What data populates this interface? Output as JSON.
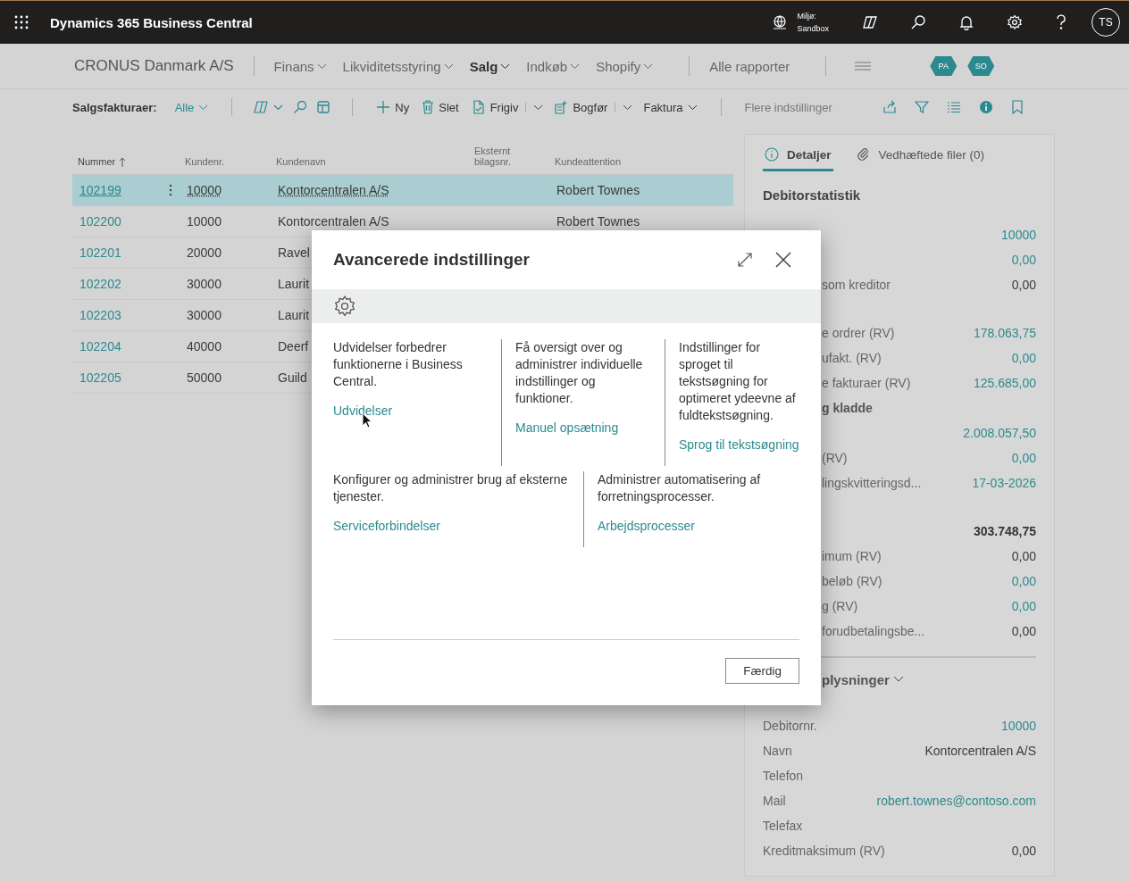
{
  "top_bar": {
    "title": "Dynamics 365 Business Central",
    "environment_label": "Miljø:",
    "environment": "Sandbox",
    "avatar": "TS"
  },
  "nav": {
    "company": "CRONUS Danmark A/S",
    "menus": [
      {
        "label": "Finans",
        "selected": false
      },
      {
        "label": "Likviditetsstyring",
        "selected": false
      },
      {
        "label": "Salg",
        "selected": true
      },
      {
        "label": "Indkøb",
        "selected": false
      },
      {
        "label": "Shopify",
        "selected": false
      }
    ],
    "reports": "Alle rapporter",
    "badges": [
      "PA",
      "SO"
    ]
  },
  "action_bar": {
    "page": "Salgsfakturaer:",
    "filter": "Alle",
    "actions": [
      {
        "label": "Ny",
        "kind": "plain"
      },
      {
        "label": "Slet",
        "kind": "plain"
      },
      {
        "label": "Frigiv",
        "kind": "split"
      },
      {
        "label": "Bogfør",
        "kind": "split"
      },
      {
        "label": "Faktura",
        "kind": "menu"
      }
    ],
    "more": "Flere indstillinger"
  },
  "table": {
    "columns": [
      {
        "label": "Nummer",
        "sorted": true
      },
      {
        "label": "Kundenr.",
        "sorted": false
      },
      {
        "label": "Kundenavn",
        "sorted": false
      },
      {
        "label": "Eksternt bilagsnr.",
        "sorted": false
      },
      {
        "label": "Kundeattention",
        "sorted": false
      }
    ],
    "rows": [
      {
        "number": "102199",
        "customer_no": "10000",
        "name": "Kontorcentralen A/S",
        "attention": "Robert Townes",
        "selected": true
      },
      {
        "number": "102200",
        "customer_no": "10000",
        "name": "Kontorcentralen A/S",
        "attention": "Robert Townes",
        "selected": false
      },
      {
        "number": "102201",
        "customer_no": "20000",
        "name": "Ravel",
        "selected": false
      },
      {
        "number": "102202",
        "customer_no": "30000",
        "name": "Laurit",
        "selected": false
      },
      {
        "number": "102203",
        "customer_no": "30000",
        "name": "Laurit",
        "selected": false
      },
      {
        "number": "102204",
        "customer_no": "40000",
        "name": "Deerf",
        "selected": false
      },
      {
        "number": "102205",
        "customer_no": "50000",
        "name": "Guild",
        "selected": false
      }
    ]
  },
  "factbox": {
    "tabs": [
      {
        "label": "Detaljer",
        "selected": true
      },
      {
        "label": "Vedhæftede filer (0)",
        "selected": false
      }
    ],
    "stats_title": "Debitorstatistik",
    "stats": [
      {
        "kind": "link",
        "value": "10000"
      },
      {
        "kind": "link",
        "value": "0,00"
      },
      {
        "kind": "text",
        "label": "som kreditor",
        "value": "0,00"
      },
      {
        "kind": "gap"
      },
      {
        "kind": "link",
        "label": "e ordrer (RV)",
        "value": "178.063,75"
      },
      {
        "kind": "link",
        "label": "ufakt. (RV)",
        "value": "0,00"
      },
      {
        "kind": "link",
        "label": "e fakturaer (RV)",
        "value": "125.685,00"
      },
      {
        "kind": "heading",
        "label": "g kladde"
      },
      {
        "kind": "link",
        "value": "2.008.057,50"
      },
      {
        "kind": "link",
        "label": "(RV)",
        "value": "0,00"
      },
      {
        "kind": "link",
        "label": "lingskvitteringsd...",
        "value": "17-03-2026"
      },
      {
        "kind": "gap"
      },
      {
        "kind": "total",
        "value": "303.748,75"
      },
      {
        "kind": "text",
        "label": "imum (RV)",
        "value": "0,00"
      },
      {
        "kind": "link",
        "label": "beløb (RV)",
        "value": "0,00"
      },
      {
        "kind": "link",
        "label": "g (RV)",
        "value": "0,00"
      },
      {
        "kind": "text",
        "label": "forudbetalingsbe...",
        "value": "0,00"
      }
    ],
    "info_title": "plysninger",
    "info": [
      {
        "kind": "link",
        "label": "Debitornr.",
        "value": "10000"
      },
      {
        "kind": "text",
        "label": "Navn",
        "value": "Kontorcentralen A/S"
      },
      {
        "kind": "text",
        "label": "Telefon"
      },
      {
        "kind": "link",
        "label": "Mail",
        "value": "robert.townes@contoso.com"
      },
      {
        "kind": "text",
        "label": "Telefax"
      },
      {
        "kind": "text",
        "label": "Kreditmaksimum (RV)",
        "value": "0,00"
      }
    ]
  },
  "dialog": {
    "title": "Avancerede indstillinger",
    "sections": [
      {
        "text": "Udvidelser forbedrer funktionerne i Business Central.",
        "link": "Udvidelser"
      },
      {
        "text": "Få oversigt over og administrer individuelle indstillinger og funktioner.",
        "link": "Manuel opsætning"
      },
      {
        "text": "Indstillinger for sproget til tekstsøgning for optimeret ydeevne af fuldtekstsøgning.",
        "link": "Sprog til tekstsøgning"
      },
      {
        "text": "Konfigurer og administrer brug af eksterne tjenester.",
        "link": "Serviceforbindelser"
      },
      {
        "text": "Administrer automatisering af forretningsprocesser.",
        "link": "Arbejdsprocesser"
      }
    ],
    "done": "Færdig"
  }
}
